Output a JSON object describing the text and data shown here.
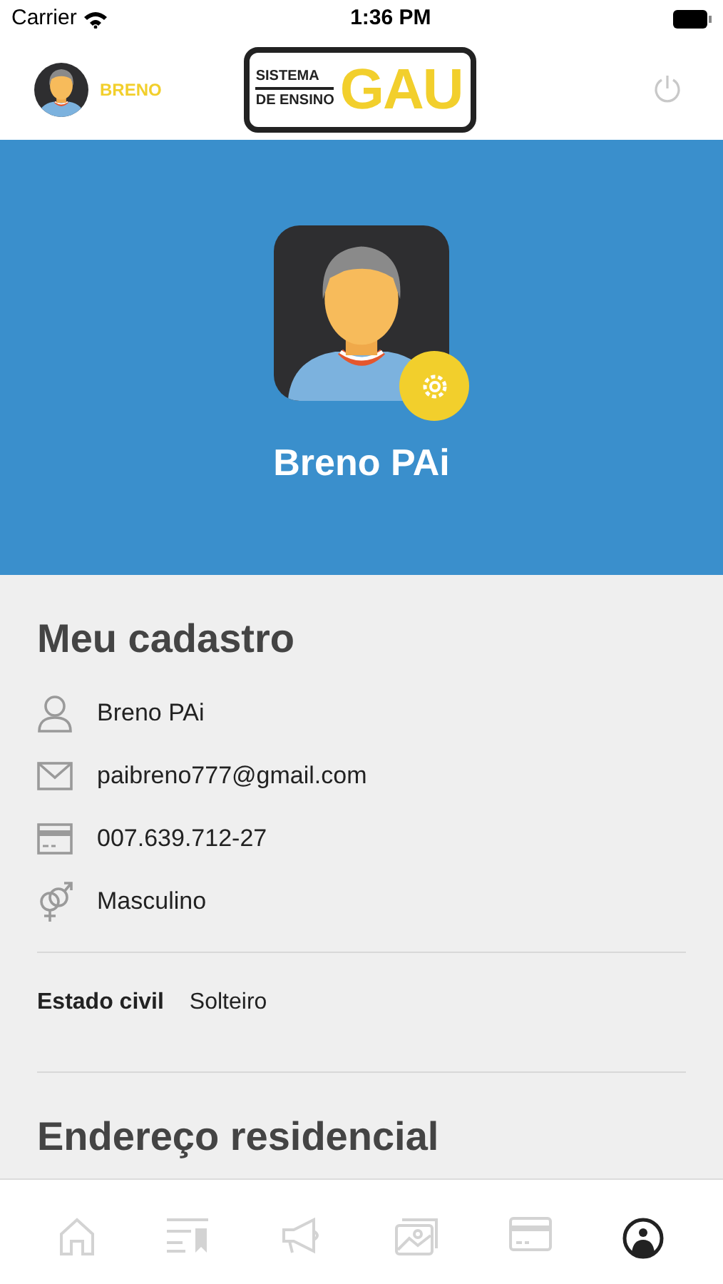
{
  "status_bar": {
    "carrier": "Carrier",
    "time": "1:36 PM"
  },
  "header": {
    "user_name": "BRENO",
    "logo": {
      "line_1": "SISTEMA",
      "line_2": "DE ENSINO",
      "brand": "GAU"
    }
  },
  "profile": {
    "name": "Breno PAi"
  },
  "registration": {
    "title": "Meu cadastro",
    "items": [
      {
        "kind": "person",
        "value": "Breno PAi"
      },
      {
        "kind": "email",
        "value": "paibreno777@gmail.com"
      },
      {
        "kind": "document",
        "value": "007.639.712-27"
      },
      {
        "kind": "gender",
        "value": "Masculino"
      }
    ],
    "marital_status": {
      "label": "Estado civil",
      "value": "Solteiro"
    }
  },
  "address": {
    "title": "Endereço residencial"
  },
  "tab_bar": [
    {
      "kind": "home",
      "selected": false
    },
    {
      "kind": "list",
      "selected": false
    },
    {
      "kind": "announcements",
      "selected": false
    },
    {
      "kind": "gallery",
      "selected": false
    },
    {
      "kind": "payments",
      "selected": false
    },
    {
      "kind": "profile",
      "selected": true
    }
  ]
}
